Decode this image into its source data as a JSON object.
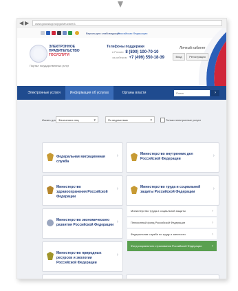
{
  "browser": {
    "back": "◀",
    "forward": "▶",
    "url": "www.gosuslugi.ru/pgu/structure/1"
  },
  "topbar": {
    "accessibility_link": "Версия для слабовидящих",
    "region_link": "Российская Федерация"
  },
  "header": {
    "logo_line1": "ЭЛЕКТРОННОЕ",
    "logo_line2": "ПРАВИТЕЛЬСТВО",
    "logo_line3": "ГОСУСЛУГИ",
    "logo_tagline": "Портал государственных услуг",
    "phones_title": "Телефоны поддержки",
    "phone1_label": "в России",
    "phone1": "8 (800) 100-70-10",
    "phone2_label": "за рубежом",
    "phone2": "+7 (499) 550-18-39",
    "login_title": "Личный кабинет",
    "login_button": "Вход",
    "register_button": "Регистрация"
  },
  "menu": {
    "tabs": [
      {
        "label": "Электронные услуги"
      },
      {
        "label": "Информация об услугах"
      },
      {
        "label": "Органы власти"
      }
    ],
    "search_placeholder": "Поиск",
    "search_icon": "›"
  },
  "filters": {
    "label1": "Искать для",
    "select1": "Физических лиц",
    "label2": "",
    "select2": "По ведомствам",
    "checkbox_label": "Только электронные услуги"
  },
  "cards": [
    {
      "label": "Федеральная миграционная служба",
      "icon": "emblem-icon"
    },
    {
      "label": "Министерство внутренних дел Российской Федерации",
      "icon": "emblem-icon"
    },
    {
      "label": "Министерство здравоохранения Российской Федерации",
      "icon": "emblem-icon"
    },
    {
      "label": "Министерство труда и социальной защиты Российской Федерации",
      "icon": "emblem-icon"
    },
    {
      "label": "Министерство экономического развития Российской Федерации",
      "icon": "emblem-icon"
    },
    {
      "label": "Министерство природных ресурсов и экологии Российской Федерации",
      "icon": "emblem-icon"
    }
  ],
  "subitems": [
    {
      "label": "Министерство труда и социальной защиты"
    },
    {
      "label": "Пенсионный фонд Российской Федерации"
    },
    {
      "label": "Федеральная служба по труду и занятости"
    },
    {
      "label": "Фонд социального страхования Российской Федерации"
    }
  ],
  "colors": {
    "menu_bar": "#1f4b8f",
    "menu_active": "#3a6cb8",
    "highlight": "#5aa050",
    "brand_red": "#d0273a"
  }
}
